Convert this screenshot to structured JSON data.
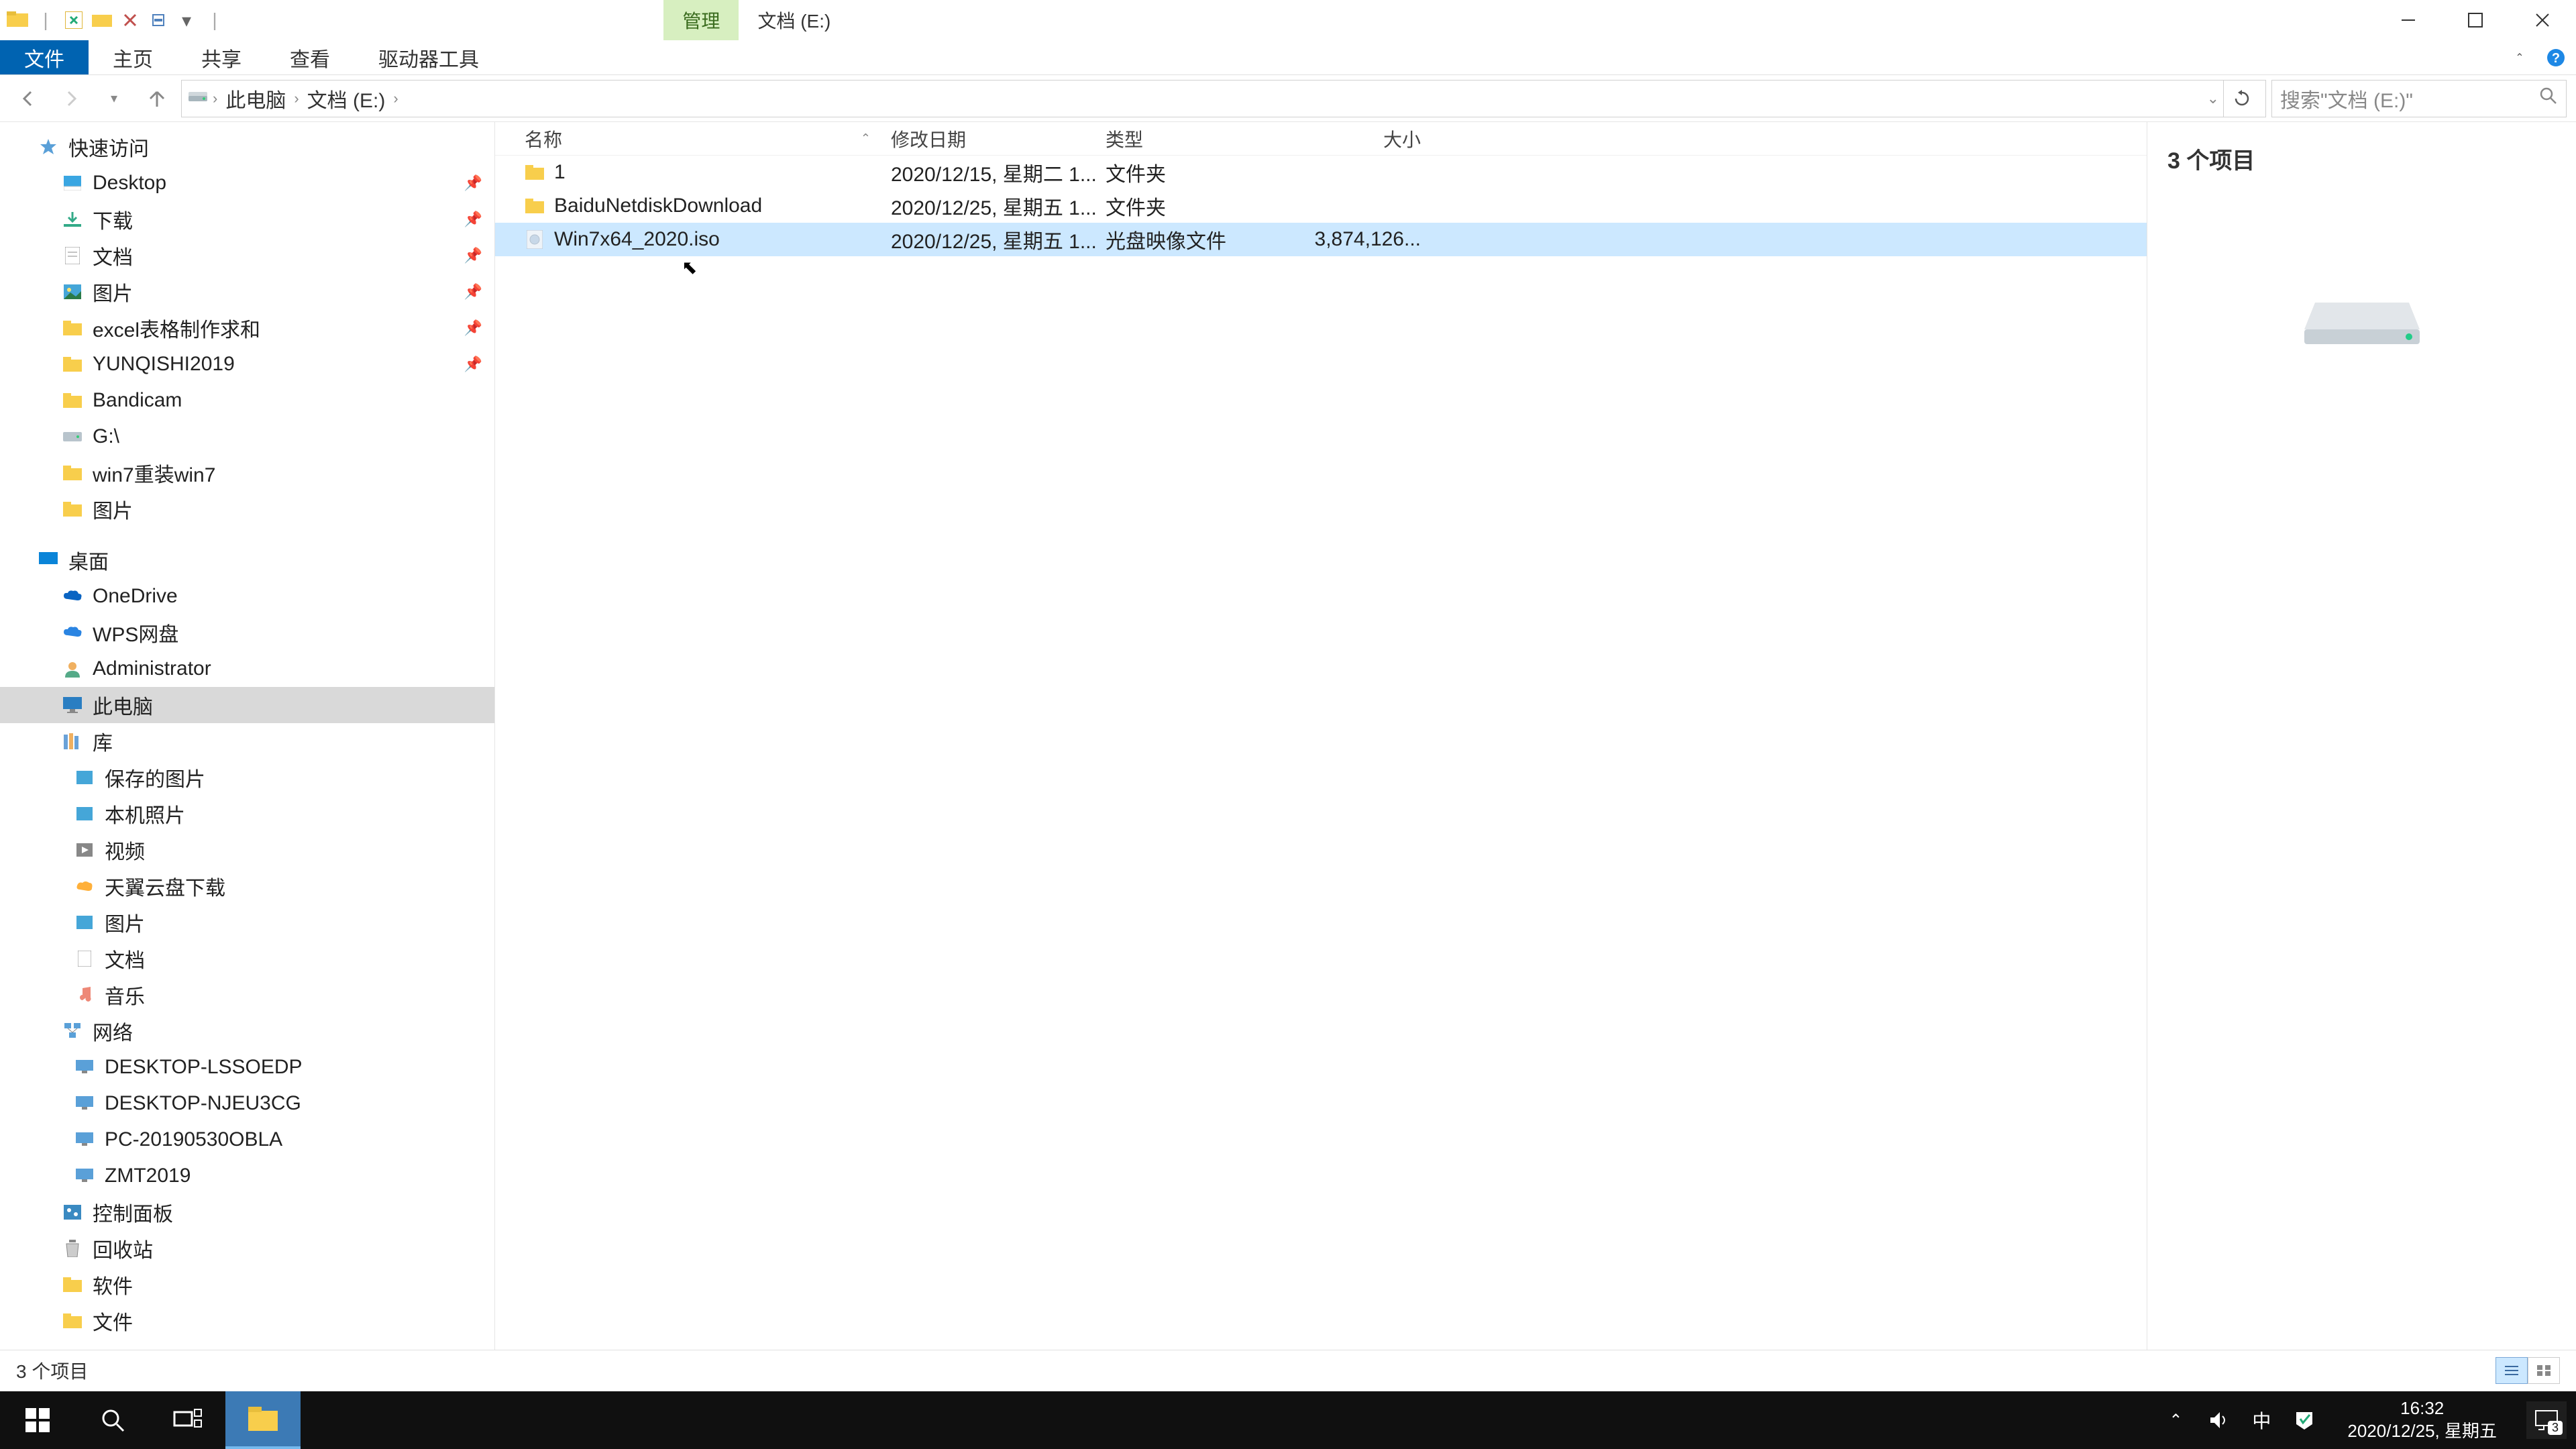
{
  "titlebar": {
    "manage_tab": "管理",
    "drive_tab": "文档 (E:)"
  },
  "ribbon": {
    "file": "文件",
    "home": "主页",
    "share": "共享",
    "view": "查看",
    "drive_tools": "驱动器工具"
  },
  "nav": {
    "breadcrumb_pc": "此电脑",
    "breadcrumb_drive": "文档 (E:)"
  },
  "search": {
    "placeholder": "搜索\"文档 (E:)\""
  },
  "tree": {
    "quick_access": "快速访问",
    "desktop2": "Desktop",
    "downloads": "下载",
    "documents": "文档",
    "pictures": "图片",
    "excel": "excel表格制作求和",
    "yunqishi": "YUNQISHI2019",
    "bandicam": "Bandicam",
    "g_drive": "G:\\",
    "win7reinstall": "win7重装win7",
    "pictures_cn": "图片",
    "desktop_cn": "桌面",
    "onedrive": "OneDrive",
    "wps": "WPS网盘",
    "admin": "Administrator",
    "this_pc": "此电脑",
    "libraries": "库",
    "saved_pics": "保存的图片",
    "camera_roll": "本机照片",
    "videos": "视频",
    "tianyi": "天翼云盘下载",
    "pics_lib": "图片",
    "docs_lib": "文档",
    "music": "音乐",
    "network": "网络",
    "pc1": "DESKTOP-LSSOEDP",
    "pc2": "DESKTOP-NJEU3CG",
    "pc3": "PC-20190530OBLA",
    "pc4": "ZMT2019",
    "control_panel": "控制面板",
    "recycle": "回收站",
    "software": "软件",
    "files": "文件"
  },
  "columns": {
    "name": "名称",
    "date": "修改日期",
    "type": "类型",
    "size": "大小"
  },
  "files": [
    {
      "name": "1",
      "date": "2020/12/15, 星期二 1...",
      "type": "文件夹",
      "size": "",
      "kind": "folder",
      "selected": false
    },
    {
      "name": "BaiduNetdiskDownload",
      "date": "2020/12/25, 星期五 1...",
      "type": "文件夹",
      "size": "",
      "kind": "folder",
      "selected": false
    },
    {
      "name": "Win7x64_2020.iso",
      "date": "2020/12/25, 星期五 1...",
      "type": "光盘映像文件",
      "size": "3,874,126...",
      "kind": "file",
      "selected": true
    }
  ],
  "preview": {
    "title": "3 个项目"
  },
  "statusbar": {
    "count": "3 个项目"
  },
  "tray": {
    "ime": "中",
    "time": "16:32",
    "date": "2020/12/25, 星期五",
    "notif_count": "3"
  }
}
